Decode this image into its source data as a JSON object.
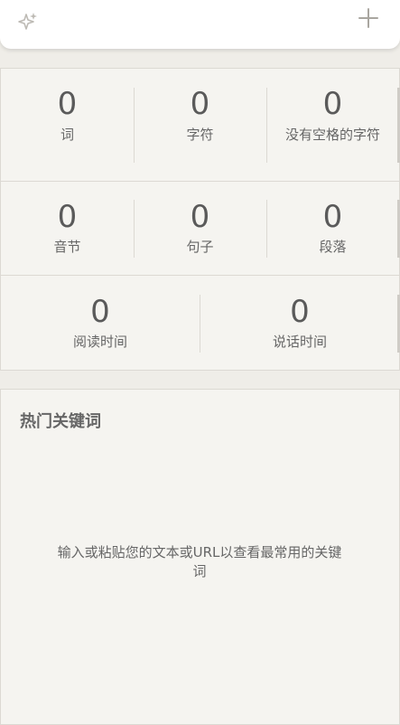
{
  "toolbar": {
    "left_icon": "sparkle-icon",
    "right_icon": "plus-icon"
  },
  "stats": {
    "words": {
      "value": "0",
      "label": "词"
    },
    "characters": {
      "value": "0",
      "label": "字符"
    },
    "characters_no_spaces": {
      "value": "0",
      "label": "没有空格的字符"
    },
    "syllables": {
      "value": "0",
      "label": "音节"
    },
    "sentences": {
      "value": "0",
      "label": "句子"
    },
    "paragraphs": {
      "value": "0",
      "label": "段落"
    },
    "reading_time": {
      "value": "0",
      "label": "阅读时间"
    },
    "speaking_time": {
      "value": "0",
      "label": "说话时间"
    }
  },
  "keywords": {
    "title": "热门关键词",
    "empty_message": "输入或粘贴您的文本或URL以查看最常用的关键词"
  }
}
